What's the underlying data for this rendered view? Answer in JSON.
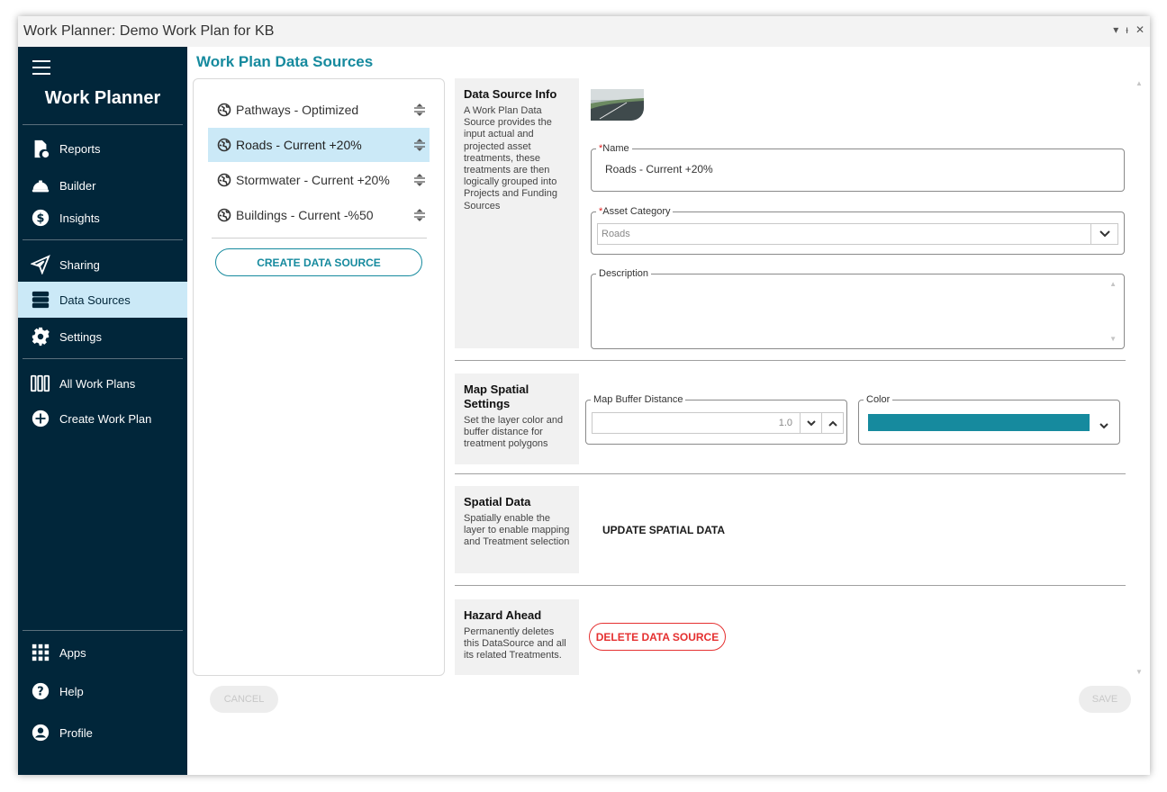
{
  "window": {
    "title": "Work Planner: Demo Work Plan for KB",
    "controls": [
      "▾",
      "ᵻ",
      "✕"
    ]
  },
  "sidebar": {
    "brand": "Work Planner",
    "items": [
      {
        "label": "Reports",
        "icon": "report-icon"
      },
      {
        "label": "Builder",
        "icon": "hardhat-icon"
      },
      {
        "label": "Insights",
        "icon": "dollar-icon"
      },
      {
        "label": "Sharing",
        "icon": "paper-plane-icon"
      },
      {
        "label": "Data Sources",
        "icon": "database-icon",
        "active": true
      },
      {
        "label": "Settings",
        "icon": "gear-icon"
      },
      {
        "label": "All Work Plans",
        "icon": "columns-icon"
      },
      {
        "label": "Create Work Plan",
        "icon": "plus-circle-icon"
      },
      {
        "label": "Apps",
        "icon": "grid-icon"
      },
      {
        "label": "Help",
        "icon": "help-icon"
      },
      {
        "label": "Profile",
        "icon": "user-icon"
      }
    ]
  },
  "page": {
    "title": "Work Plan Data Sources"
  },
  "data_sources": {
    "items": [
      {
        "label": "Pathways - Optimized"
      },
      {
        "label": "Roads - Current +20%",
        "selected": true
      },
      {
        "label": "Stormwater - Current +20%"
      },
      {
        "label": "Buildings - Current -%50"
      }
    ],
    "create_label": "CREATE DATA SOURCE"
  },
  "info": {
    "title": "Data Source Info",
    "desc": "A Work Plan Data Source provides the input actual and projected asset treatments, these treatments are then logically grouped into Projects and Funding Sources",
    "name_label": "Name",
    "name_value": "Roads - Current +20%",
    "category_label": "Asset Category",
    "category_value": "Roads",
    "description_label": "Description"
  },
  "map": {
    "title": "Map Spatial Settings",
    "desc": "Set the layer color and buffer distance for treatment polygons",
    "buffer_label": "Map Buffer Distance",
    "buffer_value": "1.0",
    "color_label": "Color",
    "color_value": "#168a9e"
  },
  "spatial": {
    "title": "Spatial Data",
    "desc": "Spatially enable the layer to enable mapping and Treatment selection",
    "update_label": "UPDATE SPATIAL DATA"
  },
  "hazard": {
    "title": "Hazard Ahead",
    "desc": "Permanently deletes this DataSource and all its related Treatments.",
    "delete_label": "DELETE DATA SOURCE"
  },
  "footer": {
    "cancel_label": "CANCEL",
    "save_label": "SAVE"
  },
  "colors": {
    "accent": "#168a9e",
    "sidebar": "#01263a",
    "active": "#cbe9f7",
    "danger": "#e53030"
  }
}
